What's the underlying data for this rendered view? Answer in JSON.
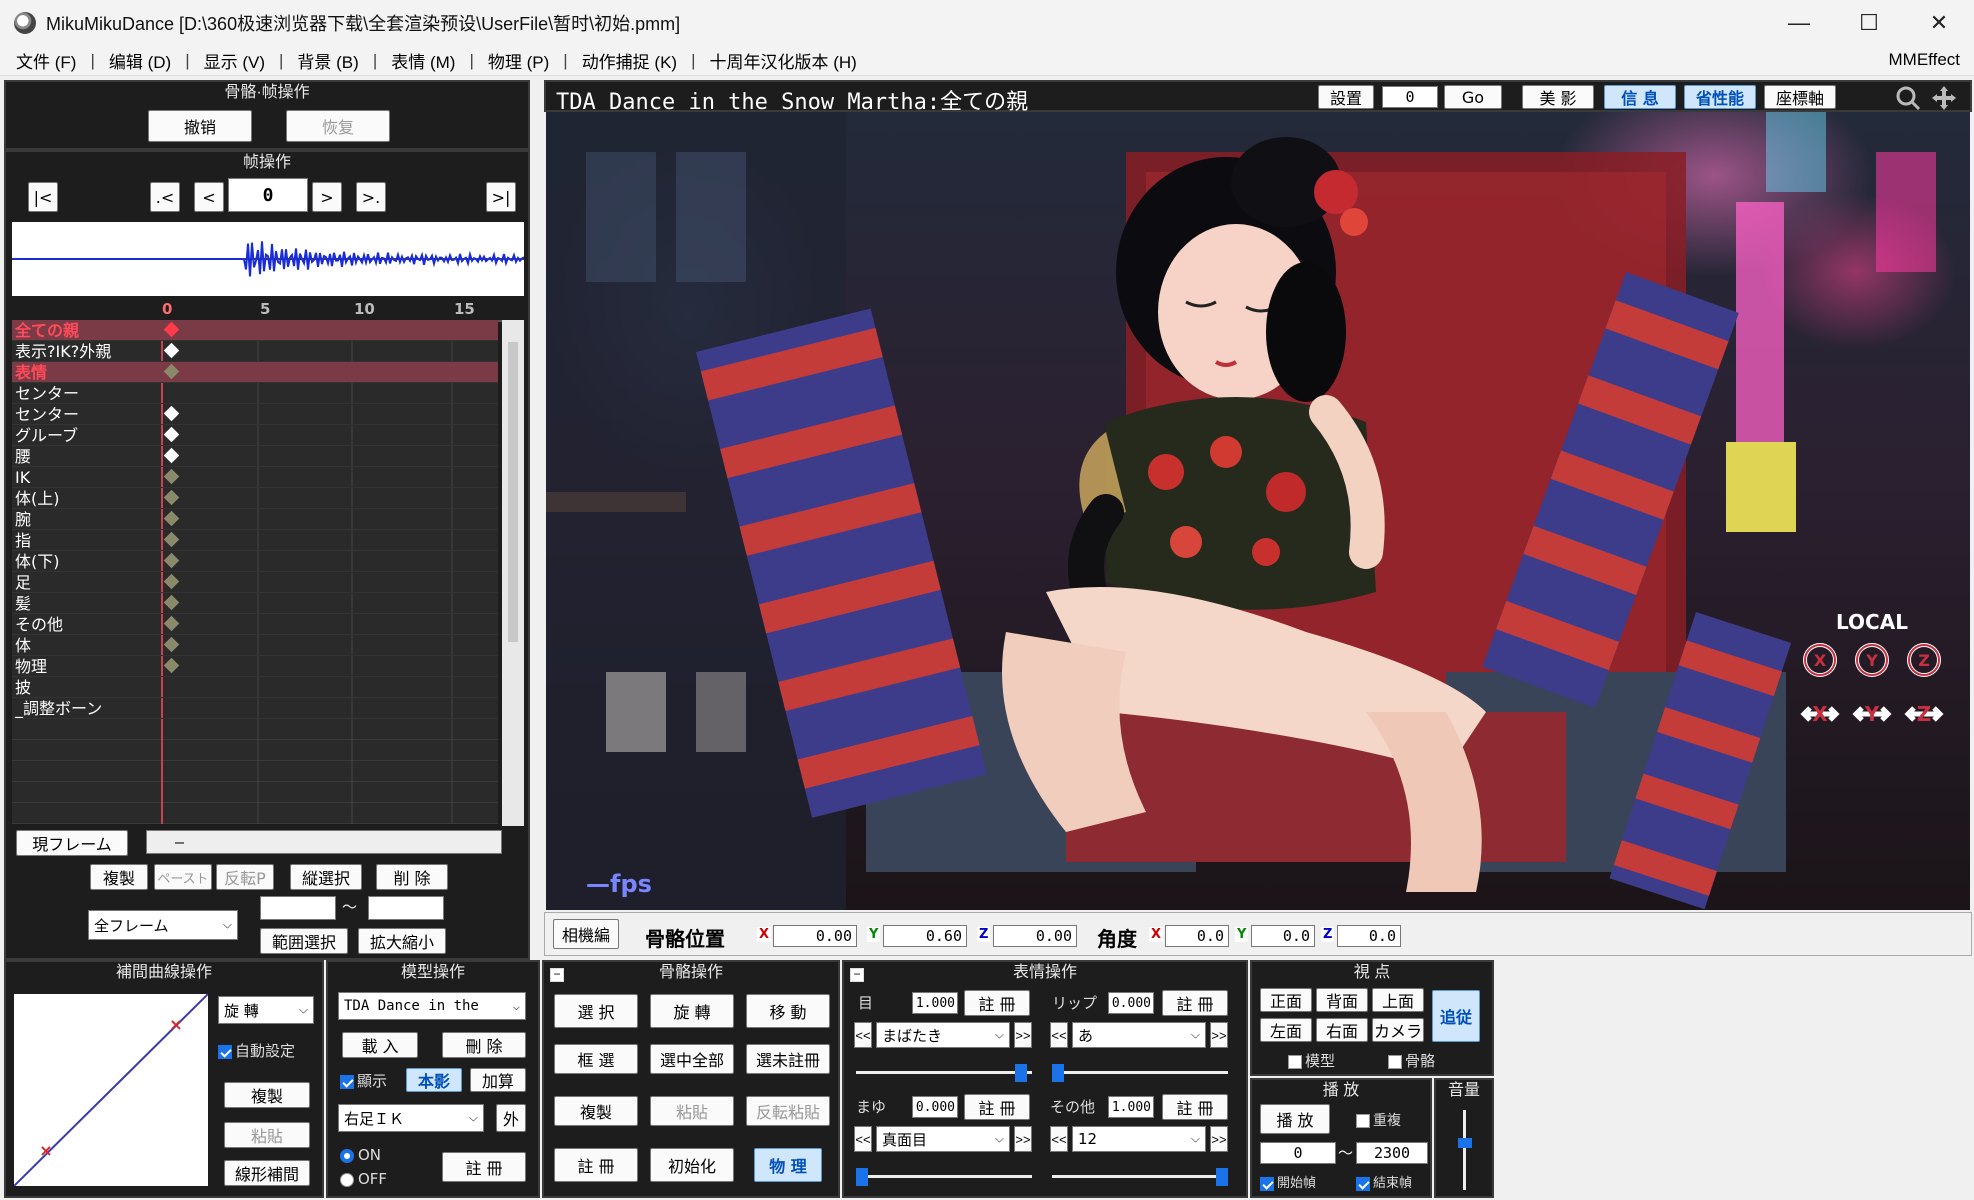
{
  "window": {
    "title": "MikuMikuDance [D:\\360极速浏览器下载\\全套渲染预设\\UserFile\\暂时\\初始.pmm]",
    "buttons": [
      "—",
      "☐",
      "✕"
    ]
  },
  "menu": {
    "items": [
      "文件 (F)",
      "编辑 (D)",
      "显示 (V)",
      "背景 (B)",
      "表情 (M)",
      "物理 (P)",
      "动作捕捉 (K)",
      "十周年汉化版本 (H)"
    ],
    "right": "MMEffect"
  },
  "bone_frame_ops": {
    "title": "骨骼·帧操作",
    "undo": "撤销",
    "redo": "恢复"
  },
  "frame_ops": {
    "title": "帧操作",
    "first": "|<",
    "prev_key": ".<",
    "prev": "<",
    "frame_value": "0",
    "next": ">",
    "next_key": ">.",
    "last": ">|"
  },
  "timeline": {
    "ruler": [
      "0",
      "5",
      "10",
      "15"
    ],
    "rows": [
      {
        "label": "全ての親",
        "style": "red",
        "key": "red",
        "hl": true
      },
      {
        "label": "表示?IK?外親",
        "style": "",
        "key": "white",
        "hl": false
      },
      {
        "label": "表情",
        "style": "red",
        "key": "dim",
        "hl": true
      },
      {
        "label": "センター",
        "style": "",
        "key": "",
        "hl": false
      },
      {
        "label": "センター",
        "style": "",
        "key": "white",
        "hl": false
      },
      {
        "label": "グルーブ",
        "style": "",
        "key": "white",
        "hl": false
      },
      {
        "label": "腰",
        "style": "",
        "key": "white",
        "hl": false
      },
      {
        "label": "IK",
        "style": "",
        "key": "dim",
        "hl": false
      },
      {
        "label": "体(上)",
        "style": "",
        "key": "dim",
        "hl": false
      },
      {
        "label": "腕",
        "style": "",
        "key": "dim",
        "hl": false
      },
      {
        "label": "指",
        "style": "",
        "key": "dim",
        "hl": false
      },
      {
        "label": "体(下)",
        "style": "",
        "key": "dim",
        "hl": false
      },
      {
        "label": "足",
        "style": "",
        "key": "dim",
        "hl": false
      },
      {
        "label": "髪",
        "style": "",
        "key": "dim",
        "hl": false
      },
      {
        "label": "その他",
        "style": "",
        "key": "dim",
        "hl": false
      },
      {
        "label": "体",
        "style": "",
        "key": "dim",
        "hl": false
      },
      {
        "label": "物理",
        "style": "",
        "key": "dim",
        "hl": false
      },
      {
        "label": "披",
        "style": "",
        "key": "",
        "hl": false
      },
      {
        "label": "_調整ボーン",
        "style": "",
        "key": "",
        "hl": false
      }
    ]
  },
  "frame_tools": {
    "current_frame": "現フレーム",
    "current_value": "—",
    "copy": "複製",
    "paste": "ペースト",
    "reverse_paste": "反転P",
    "vertical_select": "縦選択",
    "delete": "削 除",
    "all_frames": "全フレーム",
    "range_tilde": "～",
    "range_select": "範囲選択",
    "scale": "拡大縮小"
  },
  "viewport": {
    "title": "TDA Dance in the Snow Martha:全ての親",
    "settings": "設置",
    "frame_field": "0",
    "go": "Go",
    "beauty": "美 影",
    "info": "信 息",
    "perf": "省性能",
    "axis": "座標軸",
    "local": "LOCAL",
    "rot_axes": [
      "X",
      "Y",
      "Z"
    ],
    "move_axes": [
      "X",
      "Y",
      "Z"
    ],
    "fps": "—fps"
  },
  "bone_position_bar": {
    "camera_edit": "相機編",
    "pos_label": "骨骼位置",
    "x": "0.00",
    "y": "0.60",
    "z": "0.00",
    "angle_label": "角度",
    "ax": "0.0",
    "ay": "0.0",
    "az": "0.0"
  },
  "interp": {
    "title": "補間曲線操作",
    "mode": "旋 轉",
    "auto": "自動設定",
    "copy": "複製",
    "paste": "粘貼",
    "linear": "線形補間"
  },
  "model_ops": {
    "title": "模型操作",
    "model": "TDA Dance in the",
    "load": "載 入",
    "delete": "刪 除",
    "show": "顯示",
    "shadow": "本影",
    "add": "加算",
    "bone": "右足ＩＫ",
    "outer": "外",
    "on": "ON",
    "off": "OFF",
    "register": "註 冊"
  },
  "bone_ops": {
    "title": "骨骼操作",
    "select": "選 択",
    "rotate": "旋 轉",
    "move": "移 動",
    "box": "框 選",
    "select_all": "選中全部",
    "select_unreg": "選未註冊",
    "copy": "複製",
    "paste": "粘貼",
    "reverse_paste": "反転粘貼",
    "register": "註 冊",
    "init": "初始化",
    "physics": "物 理"
  },
  "facial_ops": {
    "title": "表情操作",
    "eye_label": "目",
    "eye_value": "1.000",
    "lip_label": "リップ",
    "lip_value": "0.000",
    "register": "註 冊",
    "eye_morph": "まばたき",
    "lip_morph": "あ",
    "brow_label": "まゆ",
    "brow_value": "0.000",
    "other_label": "その他",
    "other_value": "1.000",
    "brow_morph": "真面目",
    "other_morph": "12",
    "eye_slider": 0.97,
    "lip_slider": 0.0,
    "brow_slider": 0.0,
    "other_slider": 1.0
  },
  "view_ops": {
    "title": "視 点",
    "front": "正面",
    "back": "背面",
    "top": "上面",
    "follow": "追従",
    "left": "左面",
    "right": "右面",
    "camera": "カメラ",
    "model": "模型",
    "bone": "骨骼"
  },
  "play_ops": {
    "title": "播 放",
    "play": "播 放",
    "repeat": "重複",
    "start": "0",
    "tilde": "～",
    "end": "2300",
    "start_frame": "開始幀",
    "end_frame": "結束幀"
  },
  "volume": {
    "title": "音量",
    "level": 0.6
  },
  "colors": {
    "panel_bg": "#1d1d1d",
    "highlight_row": "#7a3a46",
    "accent_blue": "#1a73e8",
    "key_red": "#ff3a4a"
  }
}
